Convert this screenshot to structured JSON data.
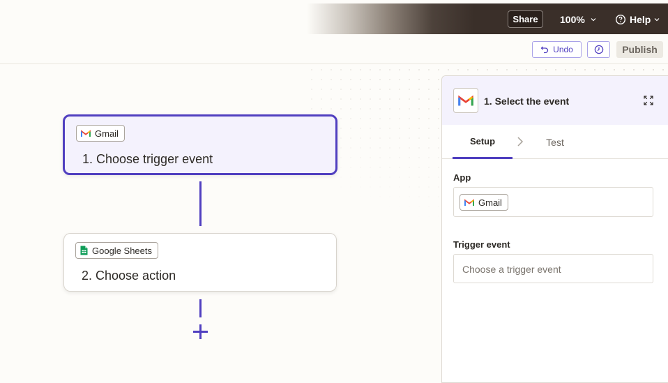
{
  "topbar": {
    "share_label": "Share",
    "zoom_label": "100%",
    "help_label": "Help"
  },
  "toolbar": {
    "undo_label": "Undo",
    "publish_label": "Publish"
  },
  "canvas": {
    "steps": [
      {
        "app": "Gmail",
        "title": "1. Choose trigger event"
      },
      {
        "app": "Google Sheets",
        "title": "2. Choose action"
      }
    ]
  },
  "panel": {
    "title": "1. Select the event",
    "tabs": [
      {
        "label": "Setup"
      },
      {
        "label": "Test"
      }
    ],
    "app_label": "App",
    "app_value": "Gmail",
    "trigger_label": "Trigger event",
    "trigger_placeholder": "Choose a trigger event"
  },
  "colors": {
    "accent": "#503fc0",
    "topbar_dark": "#3a2f29",
    "card_selected_bg": "#f4f2fd"
  },
  "icons": [
    "gmail-icon",
    "google-sheets-icon",
    "undo-icon",
    "history-icon",
    "help-icon",
    "chevron-down-icon",
    "expand-icon",
    "chevron-right-icon",
    "plus-icon"
  ]
}
